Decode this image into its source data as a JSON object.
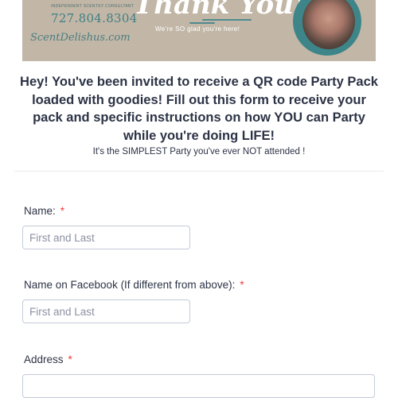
{
  "banner": {
    "brand_tagline": "INDEPENDENT SCENTSY CONSULTANT",
    "phone": "727.804.8304",
    "brand_script": "ScentDelishus.com",
    "thank_you": "Thank You!",
    "glad_text": "We're SO glad you're here!"
  },
  "form": {
    "heading": "Hey! You've been invited to receive a QR code Party Pack loaded with goodies! Fill out this form to receive your pack and specific instructions on how YOU can Party while you're doing LIFE!",
    "subheading": "It's the SIMPLEST Party you've ever NOT attended !",
    "required_marker": "*",
    "fields": [
      {
        "label": "Name:",
        "placeholder": "First and Last"
      },
      {
        "label": "Name on Facebook (If different from above):",
        "placeholder": "First and Last"
      },
      {
        "label": "Address",
        "placeholder": ""
      }
    ]
  }
}
